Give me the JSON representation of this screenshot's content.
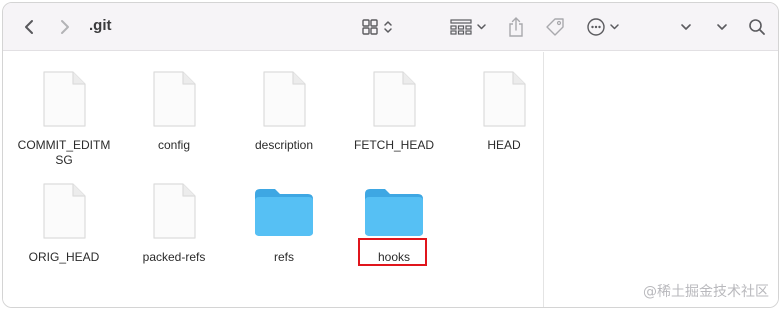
{
  "toolbar": {
    "title": ".git",
    "icons": [
      "back-chevron-icon",
      "forward-chevron-icon",
      "grid-view-icon",
      "group-by-icon",
      "share-icon",
      "tag-icon",
      "more-actions-icon",
      "chevron-down-icon",
      "search-icon"
    ]
  },
  "files": [
    {
      "name": "COMMIT_EDITMSG",
      "kind": "document"
    },
    {
      "name": "config",
      "kind": "document"
    },
    {
      "name": "description",
      "kind": "document"
    },
    {
      "name": "FETCH_HEAD",
      "kind": "document"
    },
    {
      "name": "HEAD",
      "kind": "document"
    },
    {
      "name": "ORIG_HEAD",
      "kind": "document"
    },
    {
      "name": "packed-refs",
      "kind": "document"
    },
    {
      "name": "refs",
      "kind": "folder"
    },
    {
      "name": "hooks",
      "kind": "folder"
    }
  ],
  "watermark": "@稀土掘金技术社区",
  "colors": {
    "folder": "#4fb8ef",
    "highlight": "#e0151c",
    "toolbar_bg": "#f6f4f7"
  }
}
